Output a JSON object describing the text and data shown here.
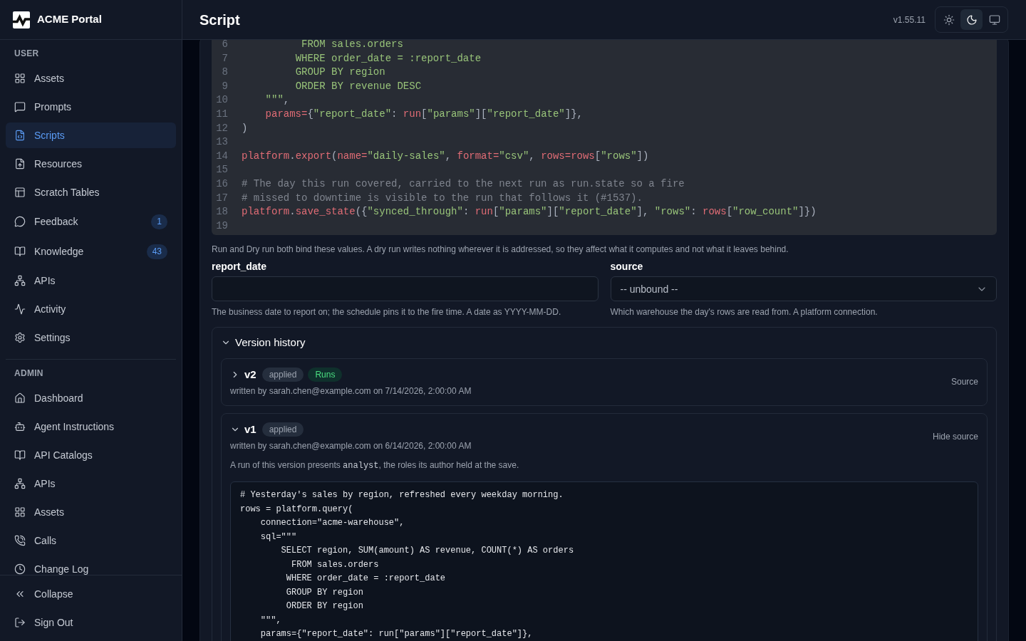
{
  "sidebar": {
    "brand": "ACME Portal",
    "sections": [
      {
        "title": "USER",
        "items": [
          {
            "label": "Assets",
            "selected": false
          },
          {
            "label": "Prompts",
            "selected": false
          },
          {
            "label": "Scripts",
            "selected": true
          },
          {
            "label": "Resources",
            "selected": false
          },
          {
            "label": "Scratch Tables",
            "selected": false
          },
          {
            "label": "Feedback",
            "selected": false,
            "badge": "1"
          },
          {
            "label": "Knowledge",
            "selected": false,
            "badge": "43"
          },
          {
            "label": "APIs",
            "selected": false
          },
          {
            "label": "Activity",
            "selected": false
          },
          {
            "label": "Settings",
            "selected": false
          }
        ]
      },
      {
        "title": "ADMIN",
        "items": [
          {
            "label": "Dashboard",
            "selected": false
          },
          {
            "label": "Agent Instructions",
            "selected": false
          },
          {
            "label": "API Catalogs",
            "selected": false
          },
          {
            "label": "APIs",
            "selected": false
          },
          {
            "label": "Assets",
            "selected": false
          },
          {
            "label": "Calls",
            "selected": false
          },
          {
            "label": "Change Log",
            "selected": false
          }
        ]
      }
    ],
    "footer": [
      {
        "label": "Collapse"
      },
      {
        "label": "Sign Out"
      }
    ]
  },
  "header": {
    "title": "Script",
    "version": "v1.55.11",
    "theme_modes": [
      {
        "kind": "light",
        "selected": false
      },
      {
        "kind": "dark",
        "selected": true
      },
      {
        "kind": "system",
        "selected": false
      }
    ]
  },
  "editor": {
    "lines": [
      {
        "number": "6",
        "tokens": [
          {
            "kind": "string",
            "text": "          FROM sales.orders"
          }
        ]
      },
      {
        "number": "7",
        "tokens": [
          {
            "kind": "string",
            "text": "         WHERE order_date = :report_date"
          }
        ]
      },
      {
        "number": "8",
        "tokens": [
          {
            "kind": "string",
            "text": "         GROUP BY region"
          }
        ]
      },
      {
        "number": "9",
        "tokens": [
          {
            "kind": "string",
            "text": "         ORDER BY revenue DESC"
          }
        ]
      },
      {
        "number": "10",
        "tokens": [
          {
            "kind": "string",
            "text": "    \"\"\""
          },
          {
            "kind": "punct",
            "text": ","
          }
        ]
      },
      {
        "number": "11",
        "tokens": [
          {
            "kind": "name",
            "text": "    params="
          },
          {
            "kind": "punct",
            "text": "{"
          },
          {
            "kind": "string",
            "text": "\"report_date\""
          },
          {
            "kind": "punct",
            "text": ": "
          },
          {
            "kind": "name",
            "text": "run"
          },
          {
            "kind": "punct",
            "text": "["
          },
          {
            "kind": "string",
            "text": "\"params\""
          },
          {
            "kind": "punct",
            "text": "]["
          },
          {
            "kind": "string",
            "text": "\"report_date\""
          },
          {
            "kind": "punct",
            "text": "]},"
          }
        ]
      },
      {
        "number": "12",
        "tokens": [
          {
            "kind": "punct",
            "text": ")"
          }
        ]
      },
      {
        "number": "13"
      },
      {
        "number": "14",
        "tokens": [
          {
            "kind": "name",
            "text": "platform"
          },
          {
            "kind": "punct",
            "text": "."
          },
          {
            "kind": "name",
            "text": "export"
          },
          {
            "kind": "punct",
            "text": "("
          },
          {
            "kind": "name",
            "text": "name="
          },
          {
            "kind": "string",
            "text": "\"daily-sales\""
          },
          {
            "kind": "punct",
            "text": ", "
          },
          {
            "kind": "name",
            "text": "format="
          },
          {
            "kind": "string",
            "text": "\"csv\""
          },
          {
            "kind": "punct",
            "text": ", "
          },
          {
            "kind": "name",
            "text": "rows=rows"
          },
          {
            "kind": "punct",
            "text": "["
          },
          {
            "kind": "string",
            "text": "\"rows\""
          },
          {
            "kind": "punct",
            "text": "])"
          }
        ]
      },
      {
        "number": "15"
      },
      {
        "number": "16",
        "tokens": [
          {
            "kind": "comment",
            "text": "# The day this run covered, carried to the next run as run.state so a fire"
          }
        ]
      },
      {
        "number": "17",
        "tokens": [
          {
            "kind": "comment",
            "text": "# missed to downtime is visible to the run that follows it (#1537)."
          }
        ]
      },
      {
        "number": "18",
        "tokens": [
          {
            "kind": "name",
            "text": "platform"
          },
          {
            "kind": "punct",
            "text": "."
          },
          {
            "kind": "name",
            "text": "save_state"
          },
          {
            "kind": "punct",
            "text": "({"
          },
          {
            "kind": "string",
            "text": "\"synced_through\""
          },
          {
            "kind": "punct",
            "text": ": "
          },
          {
            "kind": "name",
            "text": "run"
          },
          {
            "kind": "punct",
            "text": "["
          },
          {
            "kind": "string",
            "text": "\"params\""
          },
          {
            "kind": "punct",
            "text": "]["
          },
          {
            "kind": "string",
            "text": "\"report_date\""
          },
          {
            "kind": "punct",
            "text": "], "
          },
          {
            "kind": "string",
            "text": "\"rows\""
          },
          {
            "kind": "punct",
            "text": ": "
          },
          {
            "kind": "name",
            "text": "rows"
          },
          {
            "kind": "punct",
            "text": "["
          },
          {
            "kind": "string",
            "text": "\"row_count\""
          },
          {
            "kind": "punct",
            "text": "]})"
          }
        ]
      },
      {
        "number": "19"
      }
    ]
  },
  "parameters": {
    "note": "Run and Dry run both bind these values. A dry run writes nothing wherever it is addressed, so they affect what it computes and not what it leaves behind.",
    "fields": [
      {
        "kind": "text",
        "label": "report_date",
        "hint": "The business date to report on; the schedule pins it to the fire time. A date as YYYY-MM-DD."
      },
      {
        "kind": "select",
        "label": "source",
        "value": "-- unbound --",
        "hint": "Which warehouse the day's rows are read from. A platform connection."
      }
    ]
  },
  "version_history": {
    "title": "Version history",
    "expanded": true,
    "versions": [
      {
        "version": "v2",
        "expanded": false,
        "badges": [
          {
            "kind": "neutral",
            "label": "applied"
          },
          {
            "kind": "success",
            "label": "Runs"
          }
        ],
        "author_line": "written by sarah.chen@example.com on 7/14/2026, 2:00:00 AM",
        "toggle": "Source"
      },
      {
        "version": "v1",
        "expanded": true,
        "badges": [
          {
            "kind": "neutral",
            "label": "applied"
          }
        ],
        "author_line": "written by sarah.chen@example.com on 6/14/2026, 2:00:00 AM",
        "toggle": "Hide source",
        "note": [
          {
            "kind": "text",
            "text": "A run of this version presents "
          },
          {
            "kind": "code",
            "text": "analyst"
          },
          {
            "kind": "text",
            "text": ", the roles its author held at the save."
          }
        ],
        "source_lines": [
          "# Yesterday's sales by region, refreshed every weekday morning.",
          "rows = platform.query(",
          "    connection=\"acme-warehouse\",",
          "    sql=\"\"\"",
          "        SELECT region, SUM(amount) AS revenue, COUNT(*) AS orders",
          "          FROM sales.orders",
          "         WHERE order_date = :report_date",
          "         GROUP BY region",
          "         ORDER BY region",
          "    \"\"\",",
          "    params={\"report_date\": run[\"params\"][\"report_date\"]},"
        ]
      }
    ]
  }
}
